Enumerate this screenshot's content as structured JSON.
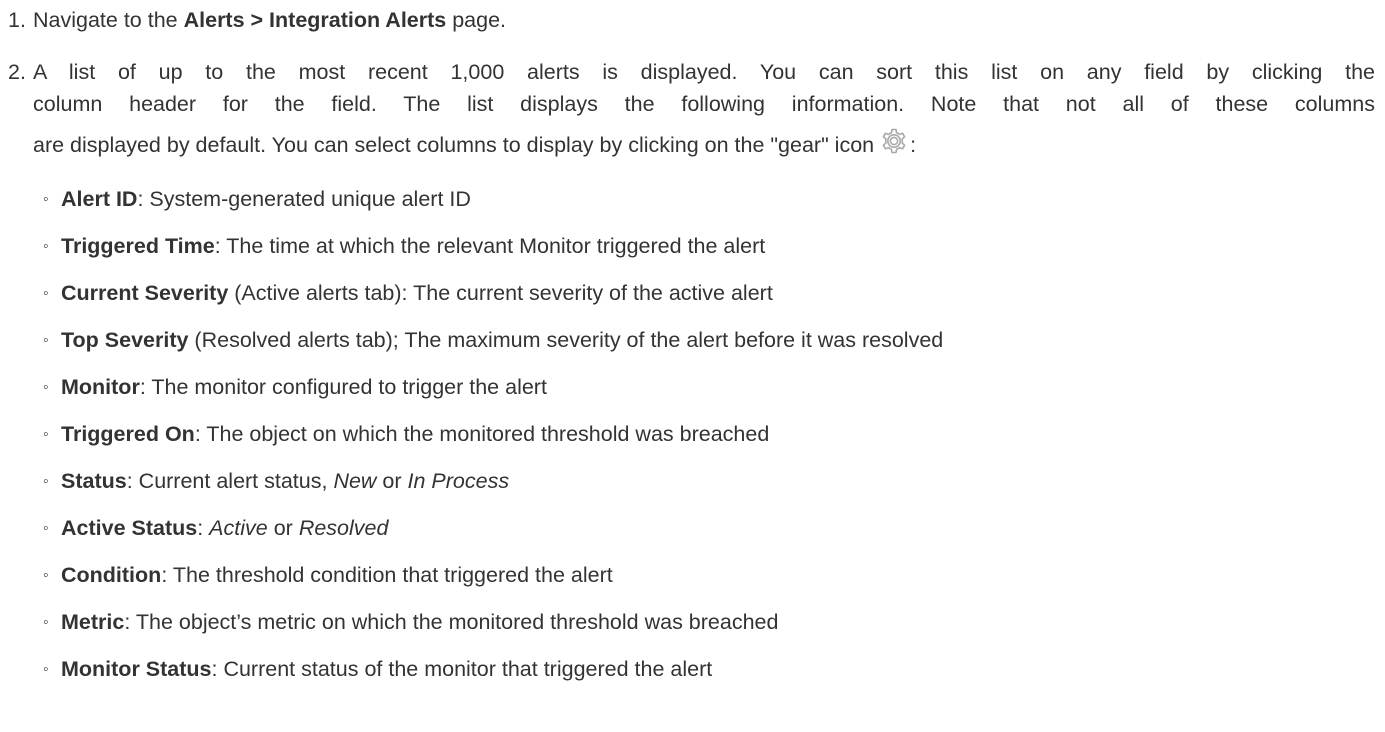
{
  "step1": {
    "number": "1.",
    "prefix": "Navigate to the ",
    "path": "Alerts > Integration Alerts",
    "suffix": " page."
  },
  "step2": {
    "number": "2.",
    "line1": "A list of up to the most recent 1,000 alerts is displayed. You can sort this list on any field by clicking the",
    "line2": "column header for the field. The list displays the following information. Note that not all of these columns",
    "line3_text": "are displayed by default. You can select columns to display by clicking on the \"gear\" icon",
    "line3_end": ":",
    "gear_icon": "gear-icon",
    "gear_color": "#a9a9a9"
  },
  "fields": [
    {
      "name": "Alert ID",
      "description": ": System-generated unique alert ID"
    },
    {
      "name": "Triggered Time",
      "description": ": The time at which the relevant Monitor triggered the alert"
    },
    {
      "name": "Current Severity",
      "description": " (Active alerts tab): The current severity of the active alert"
    },
    {
      "name": "Top Severity",
      "description": " (Resolved alerts tab); The maximum severity of the alert before it was resolved"
    },
    {
      "name": "Monitor",
      "description": ": The monitor configured to trigger the alert"
    },
    {
      "name": "Triggered On",
      "description": ": The object on which the monitored threshold was breached"
    },
    {
      "name": "Status",
      "description": ": Current alert status, ",
      "italic1": "New",
      "connector": " or ",
      "italic2": "In Process"
    },
    {
      "name": "Active Status",
      "description": ": ",
      "italic1": "Active",
      "connector": " or ",
      "italic2": "Resolved"
    },
    {
      "name": "Condition",
      "description": ": The threshold condition that triggered the alert"
    },
    {
      "name": "Metric",
      "description": ": The object’s metric on which the monitored threshold was breached"
    },
    {
      "name": "Monitor Status",
      "description": ": Current status of the monitor that triggered the alert"
    }
  ],
  "bullet_glyph": "◦"
}
